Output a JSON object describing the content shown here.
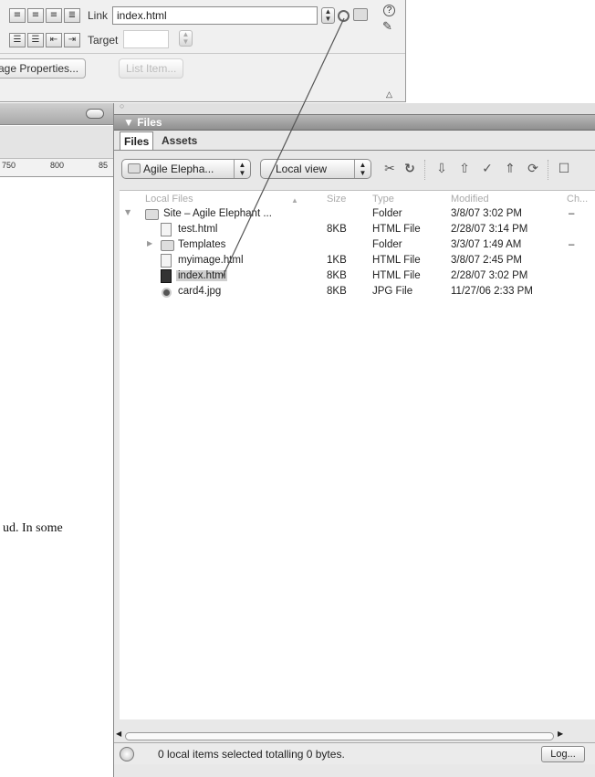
{
  "property_inspector": {
    "link_label": "Link",
    "link_value": "index.html",
    "target_label": "Target",
    "page_properties_label": "age Properties...",
    "list_item_label": "List Item..."
  },
  "document": {
    "ruler_labels": [
      "750",
      "800",
      "85"
    ],
    "body_text": "ud. In some"
  },
  "files_panel": {
    "title": "Files",
    "tabs": [
      "Files",
      "Assets"
    ],
    "site_select": "Agile Elepha...",
    "view_select": "Local view",
    "columns": [
      "Local Files",
      "Size",
      "Type",
      "Modified",
      "Ch..."
    ],
    "rows": [
      {
        "name": "Site – Agile Elephant ...",
        "size": "",
        "type": "Folder",
        "modified": "3/8/07 3:02 PM",
        "checked": "–"
      },
      {
        "name": "test.html",
        "size": "8KB",
        "type": "HTML File",
        "modified": "2/28/07 3:14 PM",
        "checked": ""
      },
      {
        "name": "Templates",
        "size": "",
        "type": "Folder",
        "modified": "3/3/07 1:49 AM",
        "checked": "–"
      },
      {
        "name": "myimage.html",
        "size": "1KB",
        "type": "HTML File",
        "modified": "3/8/07 2:45 PM",
        "checked": ""
      },
      {
        "name": "index.html",
        "size": "8KB",
        "type": "HTML File",
        "modified": "2/28/07 3:02 PM",
        "checked": ""
      },
      {
        "name": "card4.jpg",
        "size": "8KB",
        "type": "JPG File",
        "modified": "11/27/06 2:33 PM",
        "checked": ""
      }
    ],
    "status_text": "0 local items selected totalling 0 bytes.",
    "log_button": "Log..."
  },
  "colors": {
    "panel_bg": "#e8e8e8",
    "selection": "#cfcfcf",
    "link_line": "#555555"
  }
}
